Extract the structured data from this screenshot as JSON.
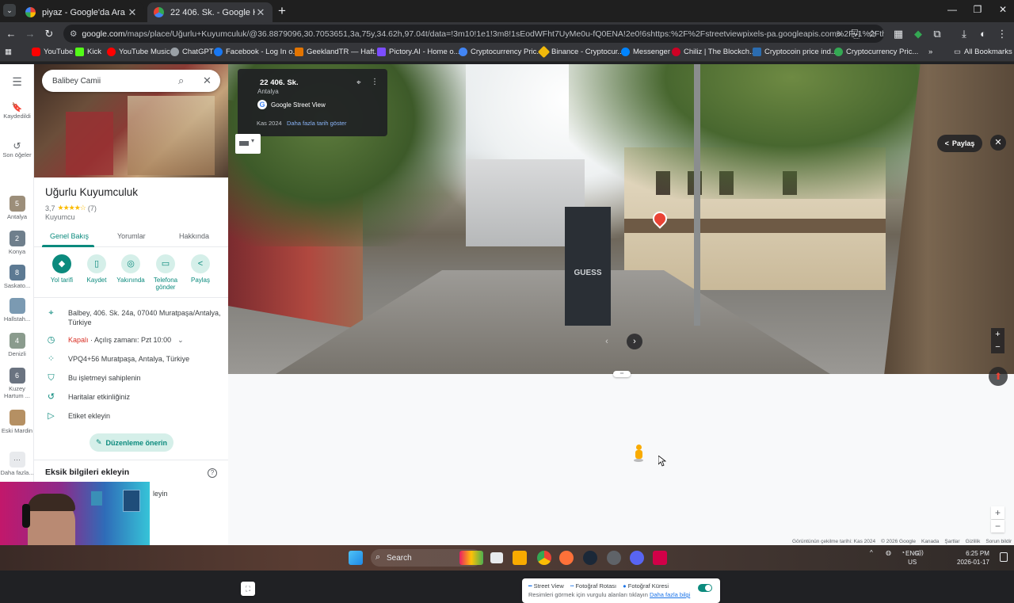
{
  "browser": {
    "tabs": [
      {
        "title": "piyaz - Google'da Ara",
        "close": "✕"
      },
      {
        "title": "22 406. Sk. - Google Haritalar",
        "close": "✕"
      }
    ],
    "new_tab": "+",
    "window_controls": {
      "minimize": "—",
      "maximize": "❐",
      "close": "✕"
    },
    "url_domain": "google.com",
    "url_rest": "/maps/place/Uğurlu+Kuyumculuk/@36.8879096,30.7053651,3a,75y,34.62h,97.04t/data=!3m10!1e1!3m8!1sEodWFht7UyMe0u-fQ0ENA!2e0!6shttps:%2F%2Fstreetviewpixels-pa.googleapis.com%2Fv1%2Fthumbnail%...",
    "bookmarks": [
      "YouTube",
      "Kick",
      "YouTube Music",
      "ChatGPT",
      "Facebook - Log In o...",
      "GeeklandTR — Haft...",
      "Pictory.AI - Home o...",
      "Cryptocurrency Pric...",
      "Binance - Cryptocur...",
      "Messenger",
      "Chiliz | The Blockch...",
      "Cryptocoin price ind...",
      "Cryptocurrency Pric..."
    ],
    "bookmarks_more": "»",
    "all_bookmarks": "All Bookmarks"
  },
  "rail": {
    "menu_icon": "☰",
    "items": [
      {
        "label": "Kaydedildi",
        "glyph": "🔖"
      },
      {
        "label": "Son öğeler",
        "glyph": "↺"
      },
      {
        "label": "Antalya",
        "badge": "5"
      },
      {
        "label": "Konya",
        "badge": "2"
      },
      {
        "label": "Saskato...",
        "badge": "8"
      },
      {
        "label": "Hallstah...",
        "badge": ""
      },
      {
        "label": "Denizli",
        "badge": "4"
      },
      {
        "label": "Kuzey Hartum ...",
        "badge": "6"
      },
      {
        "label": "Eski Mardin",
        "badge": ""
      },
      {
        "label": "Daha fazla...",
        "glyph": "···"
      }
    ]
  },
  "panel": {
    "search_value": "Balibey Camii",
    "name": "Uğurlu Kuyumculuk",
    "rating": "3,7",
    "stars": "★★★★☆",
    "review_count": "(7)",
    "category": "Kuyumcu",
    "tabs": [
      "Genel Bakış",
      "Yorumlar",
      "Hakkında"
    ],
    "actions": [
      {
        "label": "Yol tarifi",
        "glyph": "◆"
      },
      {
        "label": "Kaydet",
        "glyph": "▯"
      },
      {
        "label": "Yakınında",
        "glyph": "◎"
      },
      {
        "label": "Telefona gönder",
        "glyph": "▭"
      },
      {
        "label": "Paylaş",
        "glyph": "<"
      }
    ],
    "address": "Balbey, 406. Sk. 24a, 07040 Muratpaşa/Antalya, Türkiye",
    "hours_status": "Kapalı",
    "hours_text": " · Açılış zamanı: Pzt 10:00",
    "plus_code": "VPQ4+56 Muratpaşa, Antalya, Türkiye",
    "claim": "Bu işletmeyi sahiplenin",
    "activity": "Haritalar etkinliğiniz",
    "label_add": "Etiket ekleyin",
    "suggest_edit": "Düzenleme önerin",
    "missing_info": "Eksik bilgileri ekleyin",
    "missing_partial": "leyin"
  },
  "streetview": {
    "title": "22 406. Sk.",
    "subtitle": "Antalya",
    "provider": "Google Street View",
    "date": "Kas 2024",
    "more_dates": "Daha fazla tarih göster",
    "share": "Paylaş",
    "close": "✕",
    "kiosk_text": "GUESS",
    "zoom_in": "+",
    "zoom_out": "−"
  },
  "map": {
    "legend_items": [
      "Street View",
      "Fotoğraf Rotası",
      "Fotoğraf Küresi"
    ],
    "legend_hint": "Resimleri görmek için vurgulu alanları tıklayın",
    "legend_link": "Daha fazla bilgi",
    "footer": [
      "Görüntünün çekilme tarihi: Kas 2024",
      "© 2026 Google",
      "Kanada",
      "Şartlar",
      "Gizlilik",
      "Sorun bildir"
    ]
  },
  "taskbar": {
    "search_label": "Search",
    "lang": "ENG",
    "region": "US",
    "time": "6:25 PM",
    "date": "2026-01-17"
  },
  "colors": {
    "accent": "#0b8a7d",
    "closed": "#d93025",
    "star": "#fbbc04"
  }
}
